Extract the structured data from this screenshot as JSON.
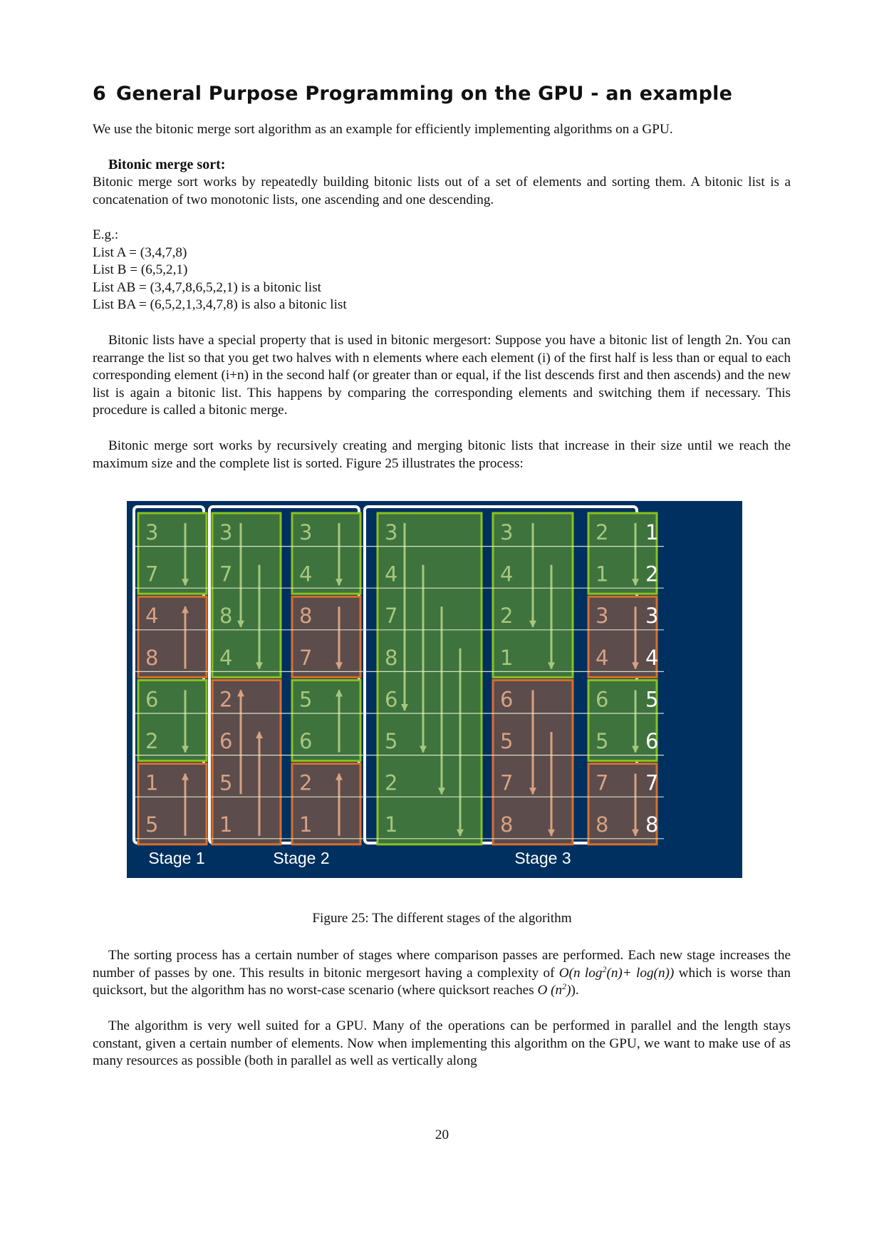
{
  "section": {
    "number": "6",
    "title": "General Purpose Programming on the GPU - an example"
  },
  "intro": "We use the bitonic merge sort algorithm as an example for efficiently implementing algorithms on a GPU.",
  "bitonic": {
    "heading": "Bitonic merge sort:",
    "definition": "Bitonic merge sort works by repeatedly building bitonic lists out of a set of elements and sorting them. A bitonic list is a concatenation of two monotonic lists, one ascending and one descending."
  },
  "example": {
    "label": "E.g.:",
    "lines": [
      "List A = (3,4,7,8)",
      "List B = (6,5,2,1)",
      "List AB = (3,4,7,8,6,5,2,1) is a bitonic list",
      "List BA = (6,5,2,1,3,4,7,8) is also a bitonic list"
    ]
  },
  "paragraphs": {
    "property": "Bitonic lists have a special property that is used in bitonic mergesort: Suppose you have a bitonic list of length 2n. You can rearrange the list so that you get two halves with n elements where each element (i) of the first half is less than or equal to each corresponding element (i+n) in the second half (or greater than or equal, if the list descends first and then ascends) and the new list is again a bitonic list. This happens by comparing the corresponding elements and switching them if necessary. This procedure is called a bitonic merge.",
    "recursive": "Bitonic merge sort works by recursively creating and merging bitonic lists that increase in their size until we reach the maximum size and the complete list is sorted. Figure 25 illustrates the process:",
    "stages_1": "The sorting process has a certain number of stages where comparison passes are performed. Each new stage increases the number of passes by one. This results in bitonic mergesort having a complexity of",
    "stages_formula": "O(n log²(n)+ log(n))",
    "stages_2": "which is worse than quicksort, but the algorithm has no worst-case scenario (where quicksort reaches",
    "stages_formula2": "O (n²)",
    "stages_3": ").",
    "gpu": "The algorithm is very well suited for a GPU. Many of the operations can be performed in parallel and the length stays constant, given a certain number of elements. Now when implementing this algorithm on the GPU, we want to make use of as many resources as possible (both in parallel as well as vertically along"
  },
  "figure": {
    "caption": "Figure 25: The different stages of the algorithm",
    "colors": {
      "background": "#00305f",
      "stage_frame": "#ffffff",
      "asc_fill": "#3e733d",
      "asc_border": "#8bc21c",
      "asc_text": "#a6c77e",
      "desc_fill": "#5c4c4c",
      "desc_border": "#d86f2c",
      "desc_text": "#d6a282",
      "index_text": "#ffffff"
    },
    "row_indices": [
      "1",
      "2",
      "3",
      "4",
      "5",
      "6",
      "7",
      "8"
    ],
    "stages": [
      {
        "label": "Stage 1",
        "columns": 1
      },
      {
        "label": "Stage 2",
        "columns": 2
      },
      {
        "label": "Stage 3",
        "columns": 3
      }
    ],
    "columns": [
      {
        "values": [
          "3",
          "7",
          "4",
          "8",
          "6",
          "2",
          "1",
          "5"
        ],
        "blocks": [
          {
            "start": 0,
            "size": 2,
            "kind": "green",
            "arrows": [
              {
                "dir": "down",
                "from": 0,
                "to": 1
              }
            ]
          },
          {
            "start": 2,
            "size": 2,
            "kind": "brown",
            "arrows": [
              {
                "dir": "up",
                "from": 0,
                "to": 1
              }
            ]
          },
          {
            "start": 4,
            "size": 2,
            "kind": "green",
            "arrows": [
              {
                "dir": "down",
                "from": 0,
                "to": 1
              }
            ]
          },
          {
            "start": 6,
            "size": 2,
            "kind": "brown",
            "arrows": [
              {
                "dir": "up",
                "from": 0,
                "to": 1
              }
            ]
          }
        ]
      },
      {
        "values": [
          "3",
          "7",
          "8",
          "4",
          "2",
          "6",
          "5",
          "1"
        ],
        "blocks": [
          {
            "start": 0,
            "size": 4,
            "kind": "green",
            "arrows": [
              {
                "dir": "down",
                "from": 0,
                "to": 2
              },
              {
                "dir": "down",
                "from": 1,
                "to": 3
              }
            ]
          },
          {
            "start": 4,
            "size": 4,
            "kind": "brown",
            "arrows": [
              {
                "dir": "up",
                "from": 0,
                "to": 2
              },
              {
                "dir": "up",
                "from": 1,
                "to": 3
              }
            ]
          }
        ]
      },
      {
        "values": [
          "3",
          "4",
          "8",
          "7",
          "5",
          "6",
          "2",
          "1"
        ],
        "blocks": [
          {
            "start": 0,
            "size": 2,
            "kind": "green",
            "arrows": [
              {
                "dir": "down",
                "from": 0,
                "to": 1
              }
            ]
          },
          {
            "start": 2,
            "size": 2,
            "kind": "brown",
            "arrows": [
              {
                "dir": "down",
                "from": 0,
                "to": 1
              }
            ]
          },
          {
            "start": 4,
            "size": 2,
            "kind": "green",
            "arrows": [
              {
                "dir": "up",
                "from": 0,
                "to": 1
              }
            ]
          },
          {
            "start": 6,
            "size": 2,
            "kind": "brown",
            "arrows": [
              {
                "dir": "up",
                "from": 0,
                "to": 1
              }
            ]
          }
        ]
      },
      {
        "values": [
          "3",
          "4",
          "7",
          "8",
          "6",
          "5",
          "2",
          "1"
        ],
        "blocks": [
          {
            "start": 0,
            "size": 8,
            "kind": "green",
            "arrows": [
              {
                "dir": "down",
                "from": 0,
                "to": 4
              },
              {
                "dir": "down",
                "from": 1,
                "to": 5
              },
              {
                "dir": "down",
                "from": 2,
                "to": 6
              },
              {
                "dir": "down",
                "from": 3,
                "to": 7
              }
            ]
          }
        ]
      },
      {
        "values": [
          "3",
          "4",
          "2",
          "1",
          "6",
          "5",
          "7",
          "8"
        ],
        "blocks": [
          {
            "start": 0,
            "size": 4,
            "kind": "green",
            "arrows": [
              {
                "dir": "down",
                "from": 0,
                "to": 2
              },
              {
                "dir": "down",
                "from": 1,
                "to": 3
              }
            ]
          },
          {
            "start": 4,
            "size": 4,
            "kind": "brown",
            "arrows": [
              {
                "dir": "down",
                "from": 0,
                "to": 2
              },
              {
                "dir": "down",
                "from": 1,
                "to": 3
              }
            ]
          }
        ]
      },
      {
        "values": [
          "2",
          "1",
          "3",
          "4",
          "6",
          "5",
          "7",
          "8"
        ],
        "blocks": [
          {
            "start": 0,
            "size": 2,
            "kind": "green",
            "arrows": [
              {
                "dir": "down",
                "from": 0,
                "to": 1
              }
            ]
          },
          {
            "start": 2,
            "size": 2,
            "kind": "brown",
            "arrows": [
              {
                "dir": "down",
                "from": 0,
                "to": 1
              }
            ]
          },
          {
            "start": 4,
            "size": 2,
            "kind": "green",
            "arrows": [
              {
                "dir": "down",
                "from": 0,
                "to": 1
              }
            ]
          },
          {
            "start": 6,
            "size": 2,
            "kind": "brown",
            "arrows": [
              {
                "dir": "down",
                "from": 0,
                "to": 1
              }
            ]
          }
        ]
      }
    ]
  },
  "page_number": "20"
}
